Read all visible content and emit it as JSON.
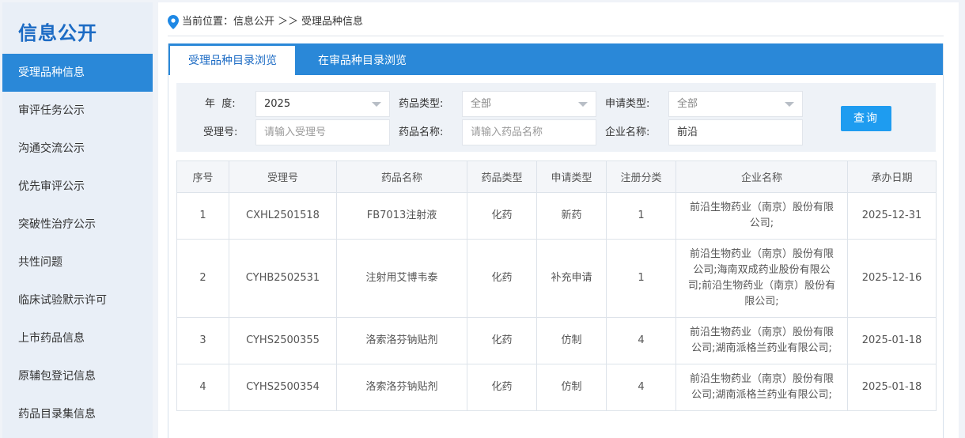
{
  "sidebar": {
    "title": "信息公开",
    "items": [
      {
        "label": "受理品种信息",
        "active": true
      },
      {
        "label": "审评任务公示"
      },
      {
        "label": "沟通交流公示"
      },
      {
        "label": "优先审评公示"
      },
      {
        "label": "突破性治疗公示"
      },
      {
        "label": "共性问题"
      },
      {
        "label": "临床试验默示许可"
      },
      {
        "label": "上市药品信息"
      },
      {
        "label": "原辅包登记信息"
      },
      {
        "label": "药品目录集信息"
      }
    ]
  },
  "breadcrumb": {
    "prefix": "当前位置：信息公开",
    "sep": "＞＞",
    "current": "受理品种信息"
  },
  "tabs": [
    "受理品种目录浏览",
    "在审品种目录浏览"
  ],
  "filters": {
    "year_label": "年  度:",
    "year_value": "2025",
    "drug_type_label": "药品类型:",
    "drug_type_value": "全部",
    "apply_type_label": "申请类型:",
    "apply_type_value": "全部",
    "accept_no_label": "受理号:",
    "accept_no_placeholder": "请输入受理号",
    "drug_name_label": "药品名称:",
    "drug_name_placeholder": "请输入药品名称",
    "company_label": "企业名称:",
    "company_value": "前沿",
    "query_button": "查询"
  },
  "table": {
    "headers": [
      "序号",
      "受理号",
      "药品名称",
      "药品类型",
      "申请类型",
      "注册分类",
      "企业名称",
      "承办日期"
    ],
    "rows": [
      [
        "1",
        "CXHL2501518",
        "FB7013注射液",
        "化药",
        "新药",
        "1",
        "前沿生物药业（南京）股份有限公司;",
        "2025-12-31"
      ],
      [
        "2",
        "CYHB2502531",
        "注射用艾博韦泰",
        "化药",
        "补充申请",
        "1",
        "前沿生物药业（南京）股份有限公司;海南双成药业股份有限公司;前沿生物药业（南京）股份有限公司;",
        "2025-12-16"
      ],
      [
        "3",
        "CYHS2500355",
        "洛索洛芬钠贴剂",
        "化药",
        "仿制",
        "4",
        "前沿生物药业（南京）股份有限公司;湖南派格兰药业有限公司;",
        "2025-01-18"
      ],
      [
        "4",
        "CYHS2500354",
        "洛索洛芬钠贴剂",
        "化药",
        "仿制",
        "4",
        "前沿生物药业（南京）股份有限公司;湖南派格兰药业有限公司;",
        "2025-01-18"
      ]
    ]
  }
}
